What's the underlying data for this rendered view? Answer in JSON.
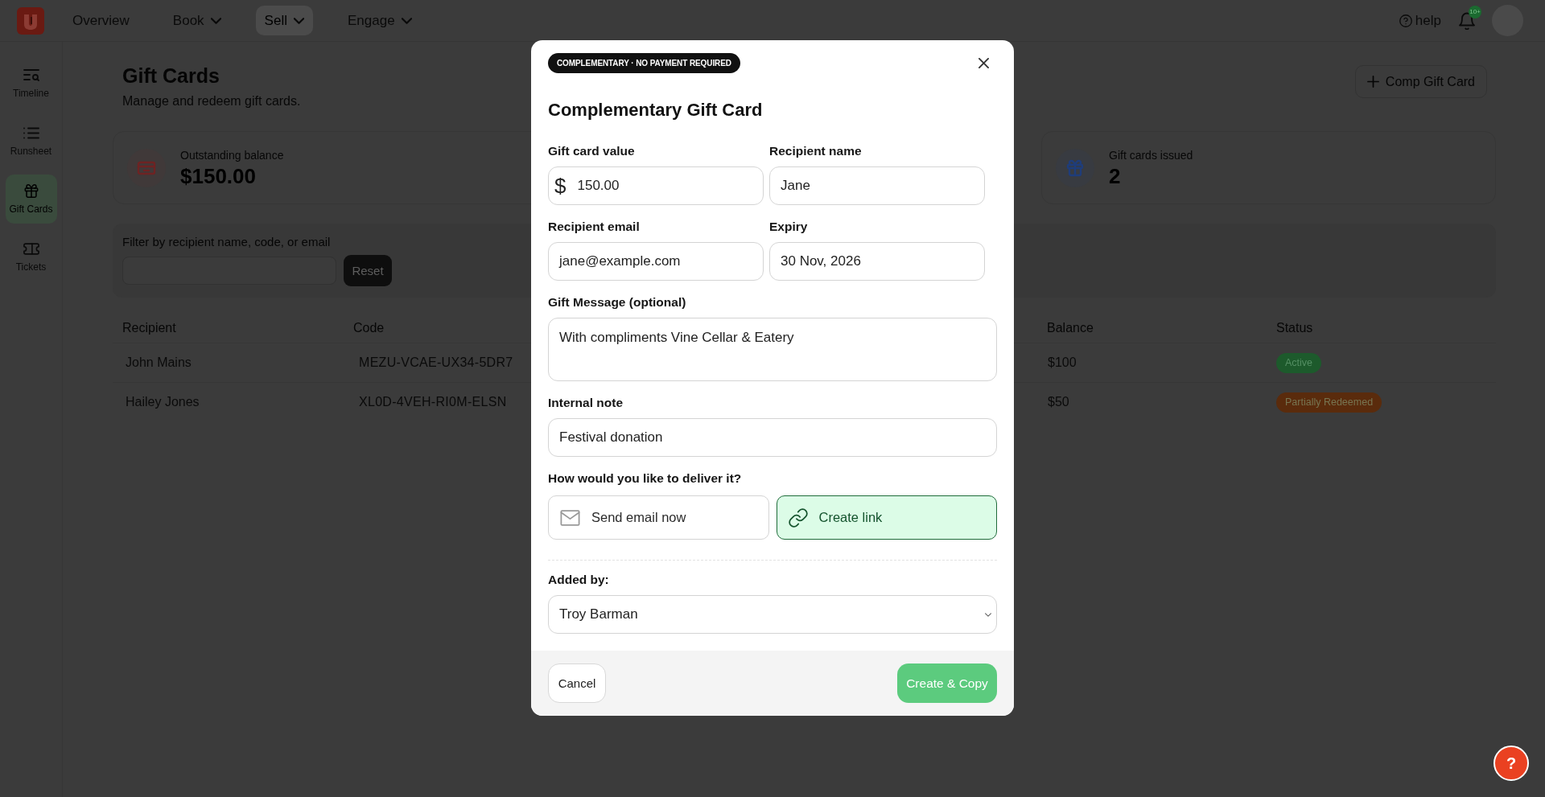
{
  "top_bar": {
    "nav": [
      {
        "label": "Overview",
        "has_menu": false,
        "selected": false
      },
      {
        "label": "Book",
        "has_menu": true,
        "selected": false
      },
      {
        "label": "Sell",
        "has_menu": true,
        "selected": true
      },
      {
        "label": "Engage",
        "has_menu": true,
        "selected": false
      }
    ],
    "help_link": "help",
    "notification_badge": "10+"
  },
  "sidebar": {
    "items": [
      {
        "label": "Timeline",
        "selected": false
      },
      {
        "label": "Runsheet",
        "selected": false
      },
      {
        "label": "Gift Cards",
        "selected": true
      },
      {
        "label": "Tickets",
        "selected": false
      }
    ]
  },
  "header": {
    "title": "Gift Cards",
    "subtitle": "Manage and redeem gift cards.",
    "action_button": "Comp Gift Card"
  },
  "stats": [
    {
      "label": "Outstanding balance",
      "value": "$150.00",
      "color": "#6e2323"
    },
    {
      "label": "Gift cards issued",
      "value": "2",
      "color": "#1f3d7a"
    }
  ],
  "filter": {
    "label": "Filter by recipient name, code, or email",
    "reset_button": "Reset"
  },
  "table": {
    "columns": [
      "Recipient",
      "Code",
      "Balance",
      "Status"
    ],
    "rows": [
      {
        "recipient": "John Mains",
        "code": "MEZU-VCAE-UX34-5DR7",
        "balance": "$100",
        "status": "Active",
        "color": "#1d5a2c"
      },
      {
        "recipient": "Hailey Jones",
        "code": "XL0D-4VEH-RI0M-ELSN",
        "balance": "$50",
        "status": "Partially Redeemed",
        "color": "#5a2b0c"
      }
    ]
  },
  "modal": {
    "badge": "COMPLEMENTARY · NO PAYMENT REQUIRED",
    "title": "Complementary Gift Card",
    "fields": [
      {
        "label": "Gift card value",
        "prefix": "$",
        "value": "150.00"
      },
      {
        "label": "Recipient name",
        "value": "Jane"
      },
      {
        "label": "Recipient email",
        "value": "jane@example.com"
      },
      {
        "label": "Expiry",
        "value": "30 Nov, 2026"
      }
    ],
    "message": {
      "label": "Gift Message (optional)",
      "value": "With compliments Vine Cellar & Eatery"
    },
    "internal_note": {
      "label": "Internal note",
      "value": "Festival donation"
    },
    "delivery": {
      "label": "How would you like to deliver it?",
      "options": [
        {
          "label": "Send email now",
          "selected": false
        },
        {
          "label": "Create link",
          "selected": true
        }
      ]
    },
    "added_by": {
      "label": "Added by:",
      "value": "Troy Barman"
    },
    "cancel_button": "Cancel",
    "submit_button": "Create & Copy"
  },
  "help_button": "?"
}
